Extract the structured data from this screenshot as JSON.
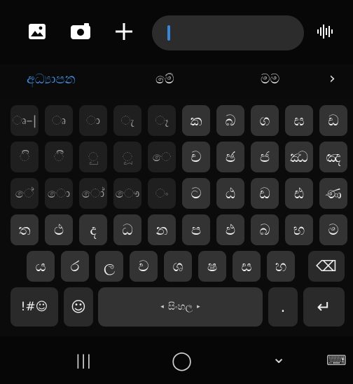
{
  "toolbar": {
    "icons": [
      "image-icon",
      "camera-icon",
      "plus-icon",
      "voice-wave-icon"
    ],
    "input_value": ""
  },
  "suggestions": {
    "items": [
      "අධ්‍යාපන",
      "මේ",
      "මම"
    ],
    "more_glyph": "›"
  },
  "keyboard": {
    "row1": [
      "ෘ–|",
      "ෘ",
      "ා",
      "ැ",
      "ෑ",
      "ක",
      "බ",
      "ග",
      "ඝ",
      "ඩ"
    ],
    "row2": [
      "ි",
      "ී",
      "ු",
      "ූ",
      "ෙ",
      "ච",
      "ඡ",
      "ජ",
      "ඣ",
      "ඤ"
    ],
    "row3": [
      "ේ",
      "ො",
      "ෝ",
      "ෞ",
      "ං",
      "ට",
      "ඨ",
      "ඩ",
      "ඪ",
      "ණ"
    ],
    "row4": [
      "ත",
      "ථ",
      "ද",
      "ධ",
      "න",
      "ප",
      "ඵ",
      "බ",
      "භ",
      "ම"
    ],
    "row5": [
      "ය",
      "ර",
      "ල",
      "ව",
      "ශ",
      "ෂ",
      "ස",
      "හ"
    ],
    "symbols_label": "!#☺",
    "emoji_glyph": "☺",
    "space_label": "සිංහල",
    "space_arrow_left": "◂",
    "space_arrow_right": "▸",
    "period_label": ".",
    "enter_glyph": "↵",
    "backspace_glyph": "⌫"
  },
  "nav": {
    "recents_glyph": "|||",
    "home_glyph": "◯",
    "back_glyph": "⌄",
    "keyboard_glyph": "⌨"
  }
}
